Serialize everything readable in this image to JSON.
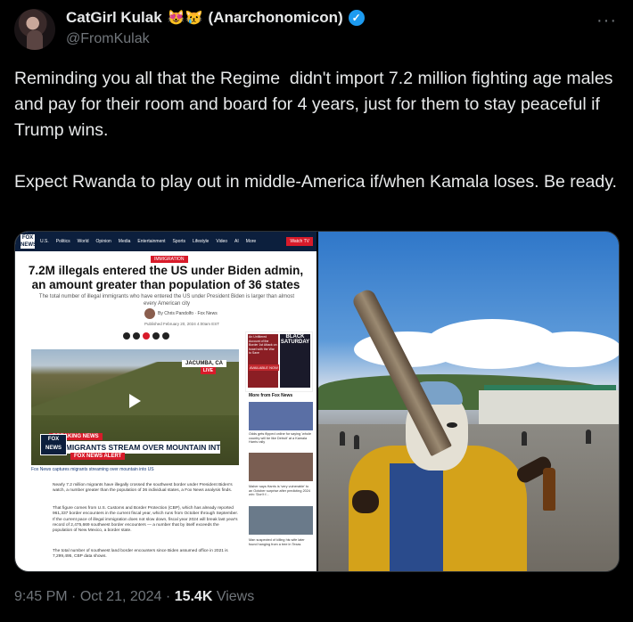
{
  "author": {
    "name": "CatGirl Kulak",
    "emojis": "😻😿",
    "name_suffix": "(Anarchonomicon)",
    "handle": "@FromKulak",
    "verified": true
  },
  "tweet": {
    "text": "Reminding you all that the Regime  didn't import 7.2 million fighting age males and pay for their room and board for 4 years, just for them to stay peaceful if Trump wins.\n\nExpect Rwanda to play out in middle-America if/when Kamala loses. Be ready.",
    "time": "9:45 PM",
    "separator": "·",
    "date": "Oct 21, 2024",
    "views_count": "15.4K",
    "views_label": "Views"
  },
  "more_icon": "more-horizontal-icon",
  "screenshot": {
    "site": "FOX NEWS",
    "nav": [
      "U.S.",
      "Politics",
      "World",
      "Opinion",
      "Media",
      "Entertainment",
      "Sports",
      "Lifestyle",
      "Video",
      "AI",
      "More"
    ],
    "nav_button": "Watch TV",
    "tag": "IMMIGRATION",
    "headline": "7.2M illegals entered the US under Biden admin, an amount greater than population of 36 states",
    "subhead": "The total number of illegal immigrants who have entered the US under President Biden is larger than almost every American city",
    "byline": "By Chris Pandolfo · Fox News",
    "date": "Published February 20, 2024 4:00am EST",
    "video": {
      "location": "JACUMBA, CA",
      "live": "LIVE",
      "breaking": "BREAKING NEWS",
      "chyron": "NOW: MIGRANTS STREAM OVER MOUNTAIN INTO U.S.",
      "alert": "FOX NEWS ALERT",
      "badge": "FOX NEWS"
    },
    "caption": "Fox News captures migrants streaming over mountain into US",
    "paragraph1": "Nearly 7.2 million migrants have illegally crossed the southwest border under President Biden's watch, a number greater than the population of 36 individual states, a Fox News analysis finds.",
    "paragraph2": "That figure comes from U.S. Customs and Border Protection (CBP), which has already reported 961,337 border encounters in the current fiscal year, which runs from October through September. If the current pace of illegal immigration does not slow down, fiscal year 2024 will break last year's record of 2,475,669 southwest border encounters — a number that by itself exceeds the population of New Mexico, a border state.",
    "paragraph3": "The total number of southwest land border encounters since Biden assumed office in 2021 is 7,299,495, CBP data shows.",
    "ad_left": "An Unfiltered Account of the Border 1st Attack on Israel with the War to Save",
    "ad_right": "BLACK SATURDAY",
    "ad_button": "AVAILABLE NOW",
    "more_from": "More from Fox News",
    "side_items": [
      "Odds gets flipped online for saying 'whole country will be like Detroit' at a Kamala Harris rally",
      "Maher says Harris is 'very vulnerable' to an October surprise after predicting 2024 win: 'Don't f...",
      "Man suspected of killing his wife later found hanging from a tree in Texas"
    ]
  }
}
